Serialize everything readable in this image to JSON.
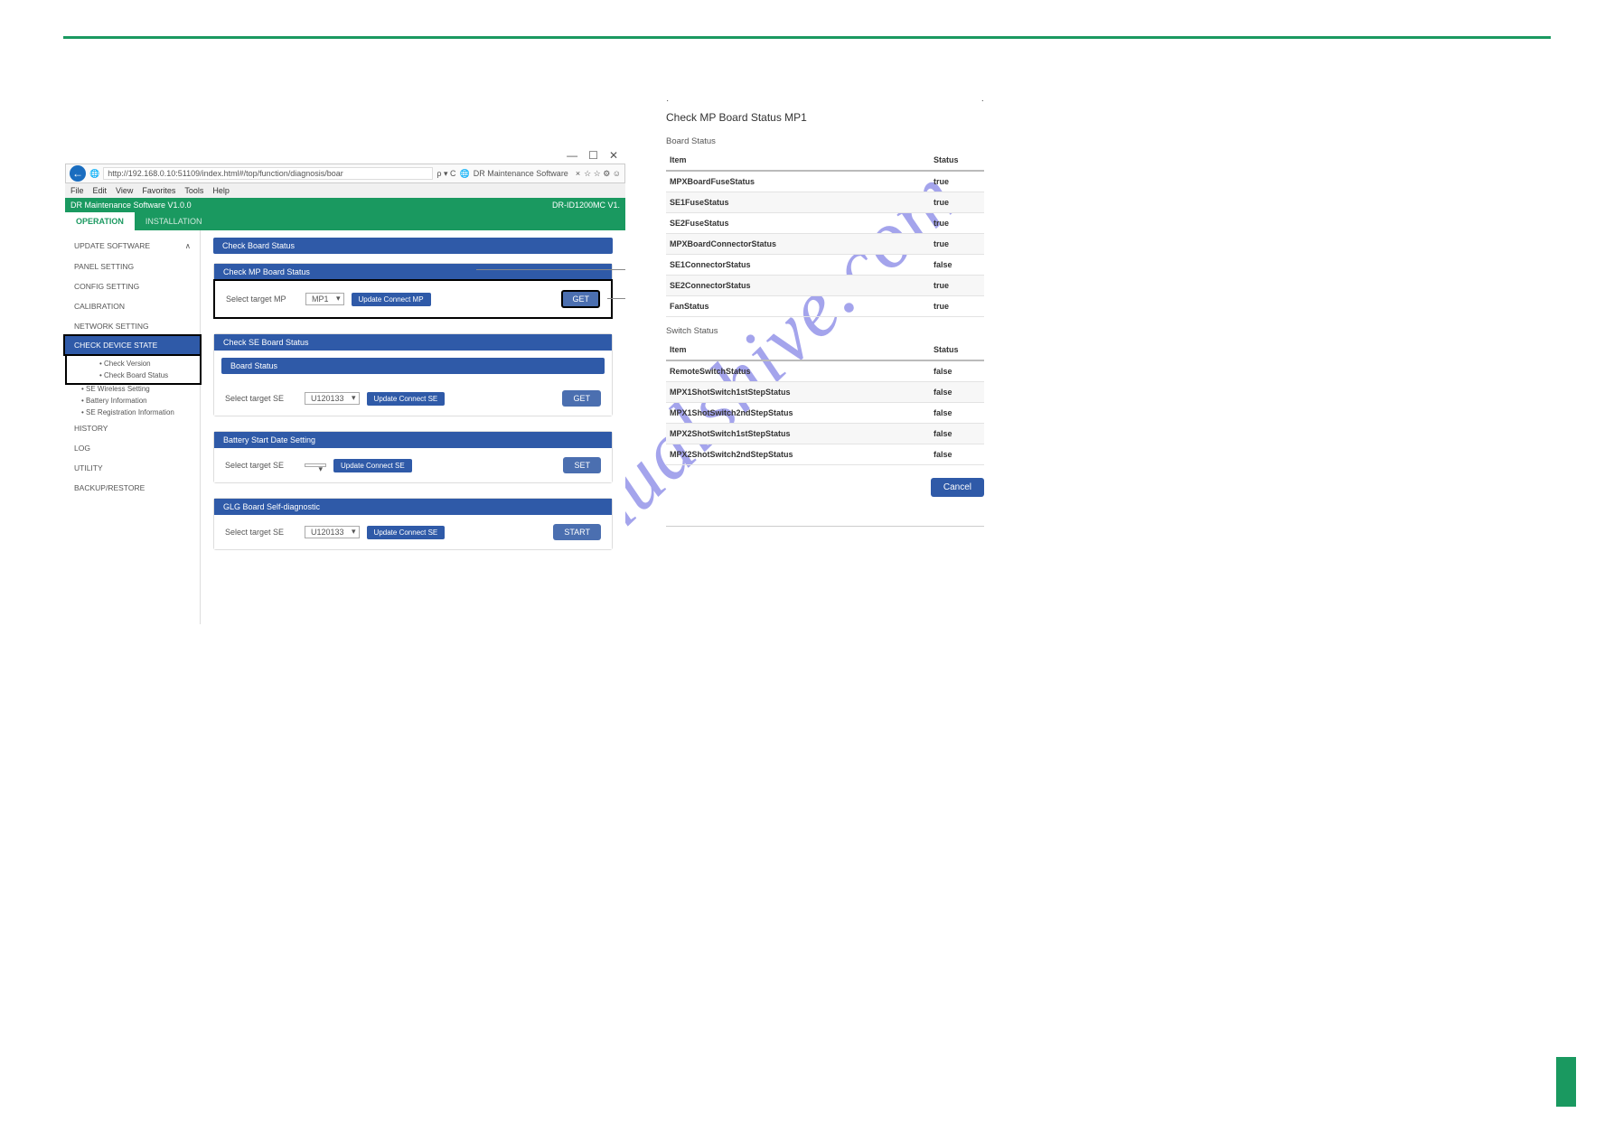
{
  "watermark": "manualshive.com",
  "left": {
    "window_controls": {
      "min": "—",
      "max": "☐",
      "close": "✕"
    },
    "url": "http://192.168.0.10:51109/index.html#/top/function/diagnosis/boar",
    "url_suffix": "ρ ▾  C",
    "tab_title": "DR Maintenance Software",
    "fav_icons": "☆ ☆ ⚙ ☺",
    "menu": [
      "File",
      "Edit",
      "View",
      "Favorites",
      "Tools",
      "Help"
    ],
    "app_title": "DR Maintenance Software V1.0.0",
    "device_id": "DR-ID1200MC V1.",
    "tabs": {
      "operation": "OPERATION",
      "installation": "INSTALLATION"
    },
    "sidebar": {
      "items": [
        "UPDATE SOFTWARE",
        "PANEL SETTING",
        "CONFIG SETTING",
        "CALIBRATION",
        "NETWORK SETTING",
        "CHECK DEVICE STATE",
        "HISTORY",
        "LOG",
        "UTILITY",
        "BACKUP/RESTORE"
      ],
      "subs": [
        "Check Version",
        "Check Board Status",
        "SE Wireless Setting",
        "Battery Information",
        "SE Registration Information"
      ],
      "chevron": "∧"
    },
    "panels": {
      "main_header": "Check Board Status",
      "mp": {
        "header": "Check MP Board Status",
        "label": "Select target MP",
        "select": "MP1",
        "update_btn": "Update Connect MP",
        "get_btn": "GET"
      },
      "se": {
        "header": "Check SE Board Status",
        "board_status": "Board Status",
        "label": "Select target SE",
        "select": "U120133",
        "update_btn": "Update Connect SE",
        "get_btn": "GET"
      },
      "battery": {
        "header": "Battery Start Date Setting",
        "label": "Select target SE",
        "select": "",
        "update_btn": "Update Connect SE",
        "set_btn": "SET"
      },
      "glg": {
        "header": "GLG Board Self-diagnostic",
        "label": "Select target SE",
        "select": "U120133",
        "update_btn": "Update Connect SE",
        "start_btn": "START"
      }
    }
  },
  "right": {
    "title": "Check MP Board Status MP1",
    "board_label": "Board Status",
    "switch_label": "Switch Status",
    "header_item": "Item",
    "header_status": "Status",
    "board_rows": [
      {
        "item": "MPXBoardFuseStatus",
        "status": "true"
      },
      {
        "item": "SE1FuseStatus",
        "status": "true"
      },
      {
        "item": "SE2FuseStatus",
        "status": "true"
      },
      {
        "item": "MPXBoardConnectorStatus",
        "status": "true"
      },
      {
        "item": "SE1ConnectorStatus",
        "status": "false"
      },
      {
        "item": "SE2ConnectorStatus",
        "status": "true"
      },
      {
        "item": "FanStatus",
        "status": "true"
      }
    ],
    "switch_rows": [
      {
        "item": "RemoteSwitchStatus",
        "status": "false"
      },
      {
        "item": "MPX1ShotSwitch1stStepStatus",
        "status": "false"
      },
      {
        "item": "MPX1ShotSwitch2ndStepStatus",
        "status": "false"
      },
      {
        "item": "MPX2ShotSwitch1stStepStatus",
        "status": "false"
      },
      {
        "item": "MPX2ShotSwitch2ndStepStatus",
        "status": "false"
      }
    ],
    "cancel": "Cancel"
  }
}
